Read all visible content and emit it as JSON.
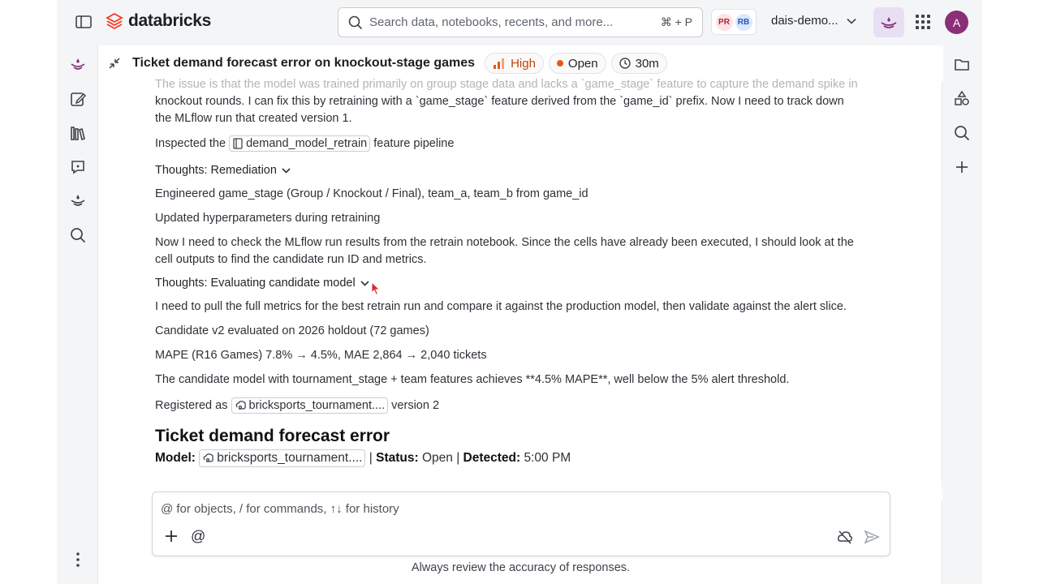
{
  "topbar": {
    "logo": "databricks",
    "search_placeholder": "Search data, notebooks, recents, and more...",
    "search_shortcut": "⌘ + P",
    "collaborators": [
      "PR",
      "RB"
    ],
    "workspace": "dais-demo...",
    "user_initial": "A"
  },
  "issue": {
    "title": "Ticket demand forecast error on knockout-stage games",
    "priority": "High",
    "status": "Open",
    "duration": "30m"
  },
  "conversation": {
    "faded_line": "The issue is that the model was trained primarily on group stage data and lacks a `game_stage` feature to capture the demand spike in",
    "para1_line1": "knockout rounds. I can fix this by retraining with a `game_stage` feature derived from the `game_id` prefix. Now I need to track down",
    "para1_line2": "the MLflow run that created version 1.",
    "inspected_prefix": "Inspected the",
    "inspected_chip": "demand_model_retrain",
    "inspected_suffix": "feature pipeline",
    "thoughts_remediation": "Thoughts: Remediation",
    "engineered": "Engineered game_stage (Group / Knockout / Final), team_a, team_b from game_id",
    "updated_hparams": "Updated hyperparameters during retraining",
    "para2_line1": "Now I need to check the MLflow run results from the retrain notebook. Since the cells have already been executed, I should look at the",
    "para2_line2": "cell outputs to find the candidate run ID and metrics.",
    "thoughts_eval": "Thoughts: Evaluating candidate model",
    "pull_metrics": "I need to pull the full metrics for the best retrain run and compare it against the production model, then validate against the alert slice.",
    "candidate_eval": "Candidate v2 evaluated on 2026 holdout (72 games)",
    "mape_line": "MAPE (R16 Games) 7.8% → 4.5%, MAE 2,864 → 2,040 tickets",
    "achieves_line": "The candidate model with tournament_stage + team features achieves **4.5% MAPE**, well below the 5% alert threshold.",
    "registered_prefix": "Registered as",
    "registered_chip": "bricksports_tournament....",
    "registered_suffix": "version 2",
    "report_heading": "Ticket demand forecast error",
    "model_label": "Model:",
    "model_chip": "bricksports_tournament....",
    "sep1": "|",
    "status_label": "Status:",
    "status_value": "Open",
    "sep2": "|",
    "detected_label": "Detected:",
    "detected_value": "5:00 PM"
  },
  "composer": {
    "placeholder": "@ for objects, / for commands, ↑↓ for history",
    "at_symbol": "@",
    "disclaimer": "Always review the accuracy of responses."
  },
  "colors": {
    "accent_purple": "#8a2f78",
    "priority_orange": "#e8590c",
    "status_dot": "#e8590c"
  }
}
